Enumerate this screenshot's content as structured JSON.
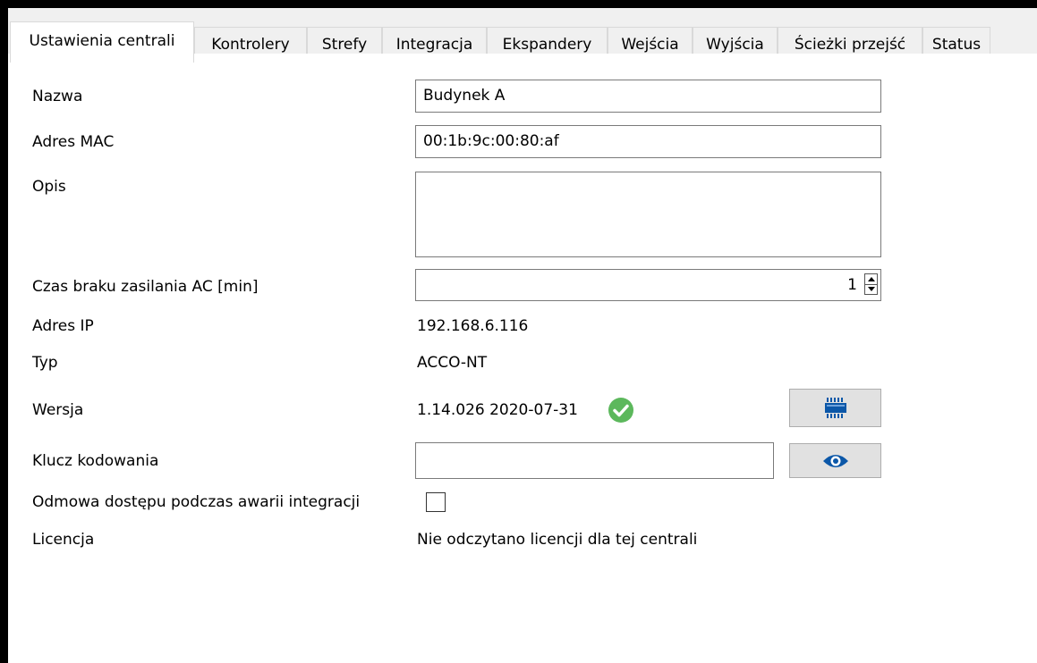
{
  "tabs": [
    {
      "label": "Ustawienia centrali",
      "active": true
    },
    {
      "label": "Kontrolery"
    },
    {
      "label": "Strefy"
    },
    {
      "label": "Integracja"
    },
    {
      "label": "Ekspandery"
    },
    {
      "label": "Wejścia"
    },
    {
      "label": "Wyjścia"
    },
    {
      "label": "Ścieżki przejść"
    },
    {
      "label": "Status"
    }
  ],
  "form": {
    "name": {
      "label": "Nazwa",
      "value": "Budynek A"
    },
    "mac": {
      "label": "Adres MAC",
      "value": "00:1b:9c:00:80:af"
    },
    "description": {
      "label": "Opis",
      "value": ""
    },
    "ac_loss": {
      "label": "Czas braku zasilania AC [min]",
      "value": "1"
    },
    "ip": {
      "label": "Adres IP",
      "value": "192.168.6.116"
    },
    "type": {
      "label": "Typ",
      "value": "ACCO-NT"
    },
    "version": {
      "label": "Wersja",
      "value": "1.14.026 2020-07-31",
      "status_color": "#5cb85c"
    },
    "encryption_key": {
      "label": "Klucz kodowania",
      "value": ""
    },
    "deny_access": {
      "label": "Odmowa dostępu podczas awarii integracji",
      "checked": false
    },
    "license": {
      "label": "Licencja",
      "value": "Nie odczytano licencji dla tej centrali"
    }
  },
  "icons": {
    "version_status": "check-circle-icon",
    "firmware_button": "chip-icon",
    "reveal_key_button": "eye-icon"
  },
  "colors": {
    "accent_blue": "#0b57a8",
    "status_green": "#5cb85c"
  }
}
